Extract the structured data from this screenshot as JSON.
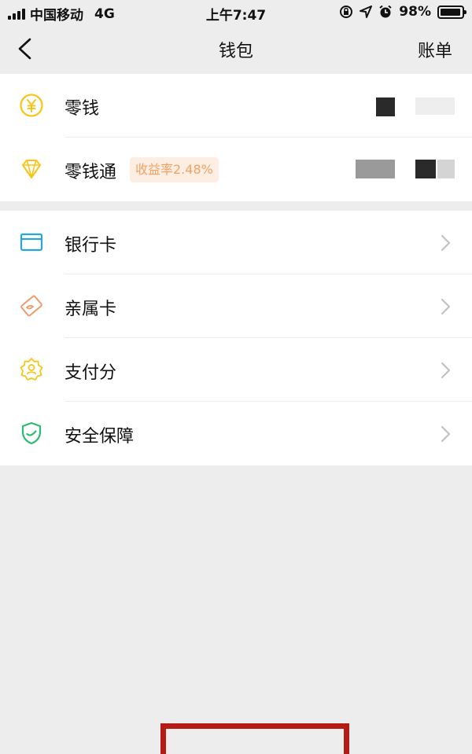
{
  "status_bar": {
    "carrier": "中国移动",
    "network": "4G",
    "time": "上午7:47",
    "battery": "98%",
    "battery_level": 0.98
  },
  "nav": {
    "title": "钱包",
    "right_label": "账单"
  },
  "balance_section": [
    {
      "label": "零钱",
      "icon": "yen-circle-icon"
    },
    {
      "label": "零钱通",
      "icon": "diamond-icon",
      "badge": "收益率2.48%"
    }
  ],
  "service_section": [
    {
      "label": "银行卡",
      "icon": "bank-card-icon"
    },
    {
      "label": "亲属卡",
      "icon": "family-card-icon"
    },
    {
      "label": "支付分",
      "icon": "pay-score-icon"
    },
    {
      "label": "安全保障",
      "icon": "shield-check-icon"
    }
  ],
  "colors": {
    "accent_yellow": "#f5c518",
    "accent_blue": "#2aa3d8",
    "accent_orange": "#f09a6a",
    "accent_green": "#2bbd6f",
    "badge_bg": "#fdeee3",
    "badge_text": "#f2a263",
    "highlight_box": "#b31b14"
  }
}
